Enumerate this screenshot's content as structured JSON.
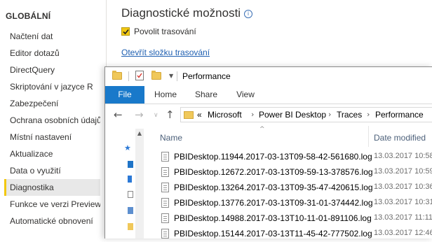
{
  "options": {
    "section_title": "GLOBÁLNÍ",
    "nav": [
      {
        "label": "Načtení dat"
      },
      {
        "label": "Editor dotazů"
      },
      {
        "label": "DirectQuery"
      },
      {
        "label": "Skriptování v jazyce R"
      },
      {
        "label": "Zabezpečení"
      },
      {
        "label": "Ochrana osobních údajů"
      },
      {
        "label": "Místní nastavení"
      },
      {
        "label": "Aktualizace"
      },
      {
        "label": "Data o využití"
      },
      {
        "label": "Diagnostika",
        "active": true
      },
      {
        "label": "Funkce ve verzi Preview"
      },
      {
        "label": "Automatické obnovení"
      }
    ],
    "main": {
      "title": "Diagnostické možnosti",
      "info_icon": "info-icon",
      "checkbox_label": "Povolit trasování",
      "checkbox_checked": true,
      "link_text": "Otevřít složku trasování"
    },
    "accent_color": "#f2c811"
  },
  "explorer": {
    "title": "Performance",
    "tabs": {
      "file": "File",
      "home": "Home",
      "share": "Share",
      "view": "View"
    },
    "file_tab_color": "#1979ca",
    "address": {
      "overflow": "«",
      "crumbs": [
        "Microsoft",
        "Power BI Desktop",
        "Traces",
        "Performance"
      ]
    },
    "columns": {
      "name": "Name",
      "date": "Date modified"
    },
    "files": [
      {
        "name": "PBIDesktop.11944.2017-03-13T09-58-42-561680.log",
        "date": "13.03.2017 10:58"
      },
      {
        "name": "PBIDesktop.12672.2017-03-13T09-59-13-378576.log",
        "date": "13.03.2017 10:59"
      },
      {
        "name": "PBIDesktop.13264.2017-03-13T09-35-47-420615.log",
        "date": "13.03.2017 10:36"
      },
      {
        "name": "PBIDesktop.13776.2017-03-13T09-31-01-374442.log",
        "date": "13.03.2017 10:31"
      },
      {
        "name": "PBIDesktop.14988.2017-03-13T10-11-01-891106.log",
        "date": "13.03.2017 11:11"
      },
      {
        "name": "PBIDesktop.15144.2017-03-13T11-45-42-777502.log",
        "date": "13.03.2017 12:46"
      }
    ]
  }
}
